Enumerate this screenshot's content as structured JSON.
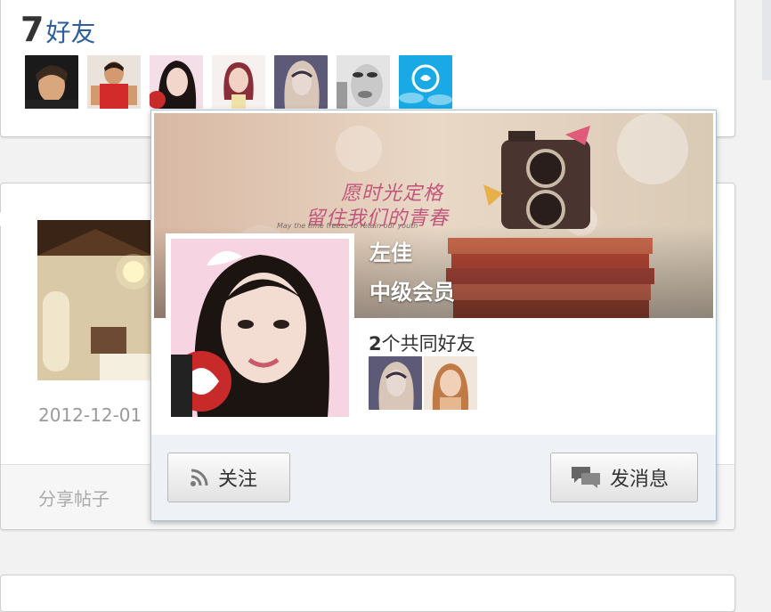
{
  "friends": {
    "count": "7",
    "label": "好友",
    "avatars": [
      {
        "name": "friend-avatar-1"
      },
      {
        "name": "friend-avatar-2"
      },
      {
        "name": "friend-avatar-3"
      },
      {
        "name": "friend-avatar-4"
      },
      {
        "name": "friend-avatar-5"
      },
      {
        "name": "friend-avatar-6"
      },
      {
        "name": "friend-avatar-7"
      }
    ]
  },
  "post": {
    "date": "2012-12-01",
    "share_label": "分享帖子"
  },
  "popup": {
    "cover_line1": "愿时光定格",
    "cover_line2": "留住我们的青春",
    "cover_small": "May the time freeze to retain our youth",
    "user_name": "左佳",
    "user_level": "中级会员",
    "mutual_count": "2",
    "mutual_text": "个共同好友",
    "follow_label": "关注",
    "message_label": "发消息"
  },
  "colors": {
    "friends_title": "#2e5f99",
    "popup_border": "#a9c0d6",
    "popup_footer": "#eef2f6"
  }
}
